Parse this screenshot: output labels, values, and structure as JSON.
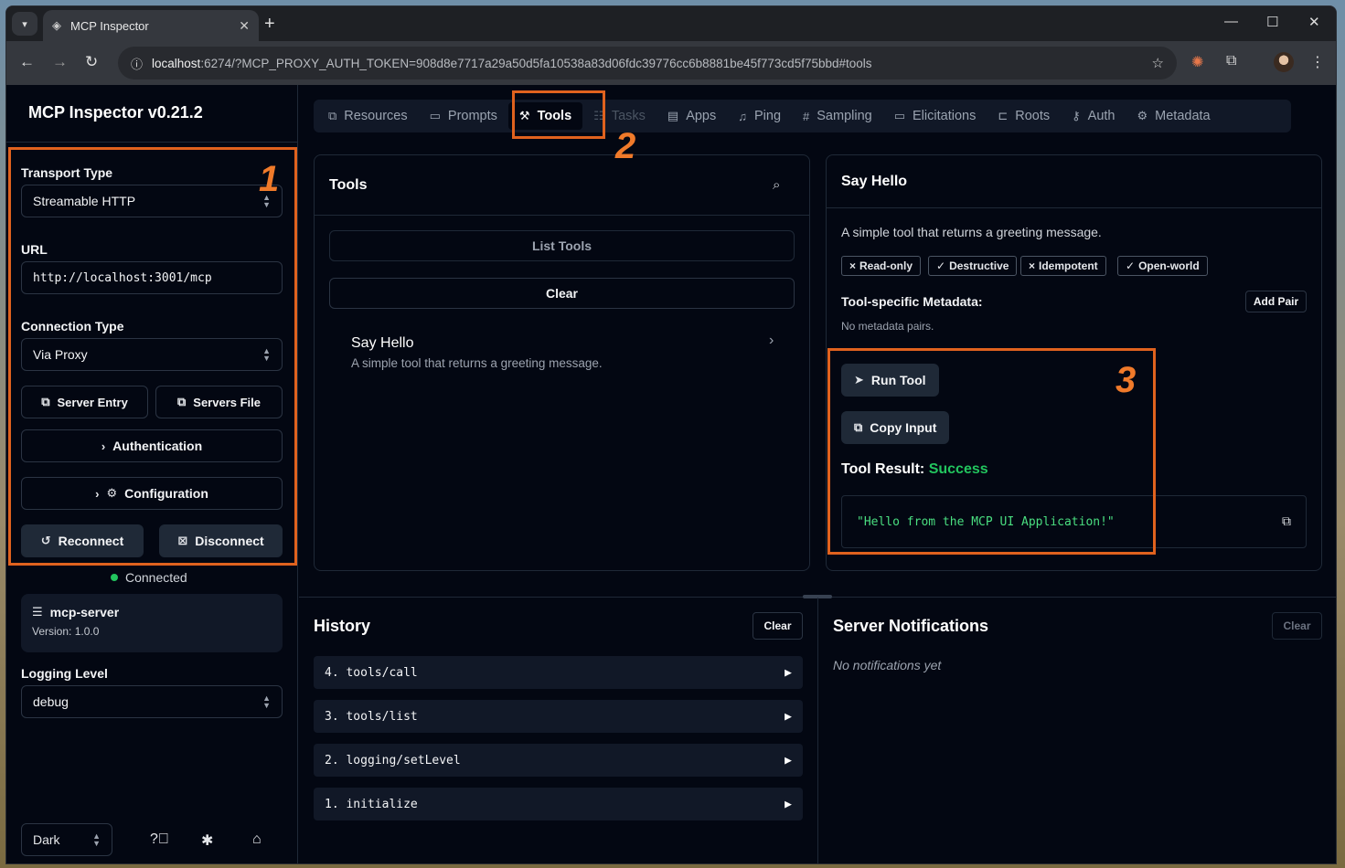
{
  "browser": {
    "tab_title": "MCP Inspector",
    "url_host": "localhost",
    "url_rest": ":6274/?MCP_PROXY_AUTH_TOKEN=908d8e7717a29a50d5fa10538a83d06fdc39776cc6b8881be45f773cd5f75bbd#tools"
  },
  "sidebar": {
    "title": "MCP Inspector v0.21.2",
    "transport_label": "Transport Type",
    "transport_value": "Streamable HTTP",
    "url_label": "URL",
    "url_value": "http://localhost:3001/mcp",
    "connection_label": "Connection Type",
    "connection_value": "Via Proxy",
    "server_entry": "Server Entry",
    "servers_file": "Servers File",
    "authentication": "Authentication",
    "configuration": "Configuration",
    "reconnect": "Reconnect",
    "disconnect": "Disconnect",
    "status": "Connected",
    "server_name": "mcp-server",
    "server_version": "Version: 1.0.0",
    "logging_label": "Logging Level",
    "logging_value": "debug",
    "theme_value": "Dark"
  },
  "tabs": [
    {
      "label": "Resources",
      "icon": "file-copy-icon"
    },
    {
      "label": "Prompts",
      "icon": "message-square-icon"
    },
    {
      "label": "Tools",
      "icon": "hammer-icon"
    },
    {
      "label": "Tasks",
      "icon": "list-icon"
    },
    {
      "label": "Apps",
      "icon": "app-window-icon"
    },
    {
      "label": "Ping",
      "icon": "bell-icon"
    },
    {
      "label": "Sampling",
      "icon": "hash-icon"
    },
    {
      "label": "Elicitations",
      "icon": "message-square-icon"
    },
    {
      "label": "Roots",
      "icon": "folder-tree-icon"
    },
    {
      "label": "Auth",
      "icon": "key-icon"
    },
    {
      "label": "Metadata",
      "icon": "gear-icon"
    }
  ],
  "tools_panel": {
    "title": "Tools",
    "list_tools": "List Tools",
    "clear": "Clear",
    "item_name": "Say Hello",
    "item_desc": "A simple tool that returns a greeting message."
  },
  "detail_panel": {
    "title": "Say Hello",
    "description": "A simple tool that returns a greeting message.",
    "badges": [
      {
        "mark": "×",
        "label": "Read-only"
      },
      {
        "mark": "✓",
        "label": "Destructive"
      },
      {
        "mark": "×",
        "label": "Idempotent"
      },
      {
        "mark": "✓",
        "label": "Open-world"
      }
    ],
    "metadata_label": "Tool-specific Metadata:",
    "add_pair": "Add Pair",
    "no_metadata": "No metadata pairs.",
    "run_tool": "Run Tool",
    "copy_input": "Copy Input",
    "result_label": "Tool Result:",
    "result_status": "Success",
    "result_text": "\"Hello from the MCP UI Application!\""
  },
  "history": {
    "title": "History",
    "clear": "Clear",
    "items": [
      "4. tools/call",
      "3. tools/list",
      "2. logging/setLevel",
      "1. initialize"
    ]
  },
  "notifications": {
    "title": "Server Notifications",
    "clear": "Clear",
    "empty": "No notifications yet"
  },
  "annotations": [
    "1",
    "2",
    "3"
  ],
  "colors": {
    "accent": "#e0621e",
    "success": "#22c55e",
    "background": "#030712"
  }
}
